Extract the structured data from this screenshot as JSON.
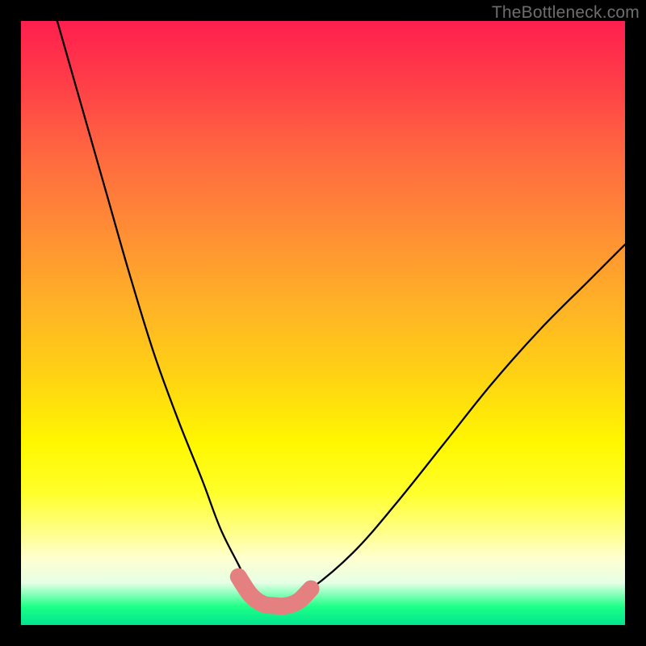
{
  "watermark": "TheBottleneck.com",
  "chart_data": {
    "type": "line",
    "title": "",
    "xlabel": "",
    "ylabel": "",
    "xlim": [
      0,
      100
    ],
    "ylim": [
      0,
      100
    ],
    "grid": false,
    "legend": false,
    "series": [
      {
        "name": "bottleneck-curve",
        "x": [
          6,
          10,
          14,
          18,
          22,
          26,
          30,
          33,
          36,
          38,
          40,
          44,
          48,
          55,
          62,
          70,
          78,
          86,
          94,
          100
        ],
        "values": [
          100,
          86,
          72,
          58,
          45,
          34,
          24,
          16,
          10,
          6,
          4,
          4,
          6,
          12,
          20,
          30,
          40,
          49,
          57,
          63
        ]
      }
    ],
    "highlight_segment": {
      "name": "well-matched-zone",
      "x": [
        36,
        38,
        40,
        42,
        44,
        46,
        48
      ],
      "values": [
        8,
        5,
        3.5,
        3.2,
        3.2,
        4,
        6
      ]
    },
    "background": "rainbow-vertical-gradient"
  }
}
